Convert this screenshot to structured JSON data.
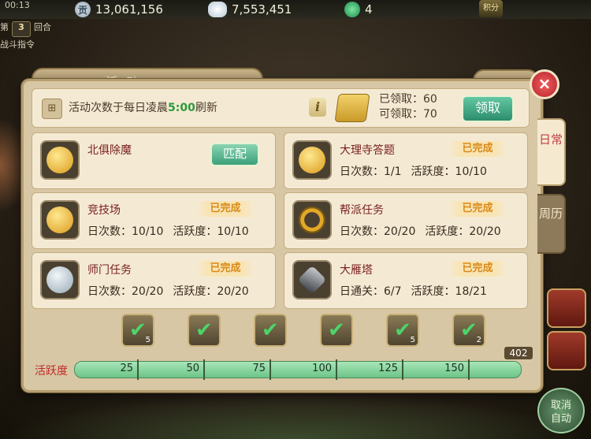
{
  "status": {
    "time": "00:13"
  },
  "currencies": [
    {
      "name": "silver-coin",
      "symbol": "贡",
      "value": "13,061,156"
    },
    {
      "name": "cloud-coin",
      "symbol": "",
      "value": "7,553,451"
    },
    {
      "name": "jade-coin",
      "symbol": "",
      "value": "4"
    }
  ],
  "top_right_icon": "积分",
  "battle": {
    "round_prefix": "第",
    "round_num": "3",
    "round_suffix": "回合",
    "command_label": "战斗指令"
  },
  "panel": {
    "title": "活动",
    "refresh_text_before": "活动次数于每日凌晨",
    "refresh_time": "5:00",
    "refresh_text_after": "刷新",
    "info_button": "i",
    "claimed": "已领取：60",
    "claimable": "可领取：70",
    "claim_button": "领取",
    "tabs": {
      "daily": "日常",
      "weekly": "周历"
    }
  },
  "activities": [
    {
      "name": "北俱除魔",
      "icon": "gold-token-icon",
      "action": "匹配",
      "status": "",
      "stat1": "",
      "stat2": ""
    },
    {
      "name": "大理寺答题",
      "icon": "gold-token-icon",
      "action": "",
      "status": "已完成",
      "stat1": "日次数：1/1",
      "stat2": "活跃度：10/10"
    },
    {
      "name": "竞技场",
      "icon": "gold-token-icon",
      "action": "",
      "status": "已完成",
      "stat1": "日次数：10/10",
      "stat2": "活跃度：10/10"
    },
    {
      "name": "帮派任务",
      "icon": "gold-ring-icon",
      "action": "",
      "status": "已完成",
      "stat1": "日次数：20/20",
      "stat2": "活跃度：20/20"
    },
    {
      "name": "师门任务",
      "icon": "silver-coin-icon",
      "action": "",
      "status": "已完成",
      "stat1": "日次数：20/20",
      "stat2": "活跃度：20/20"
    },
    {
      "name": "大雁塔",
      "icon": "tower-icon",
      "action": "",
      "status": "已完成",
      "stat1": "日通关：6/7",
      "stat2": "活跃度：18/21"
    }
  ],
  "rewards": [
    {
      "count": "5"
    },
    {
      "count": ""
    },
    {
      "count": ""
    },
    {
      "count": ""
    },
    {
      "count": "5"
    },
    {
      "count": "2"
    }
  ],
  "activeness": {
    "label": "活跃度",
    "milestones": [
      "25",
      "50",
      "75",
      "100",
      "125",
      "150"
    ],
    "total": "402",
    "fill_fraction": 1.0
  },
  "cancel_auto": {
    "line1": "取消",
    "line2": "自动"
  },
  "colors": {
    "accent_green": "#2d9a3a",
    "done_orange": "#d88a18",
    "name_red": "#7a2020"
  }
}
